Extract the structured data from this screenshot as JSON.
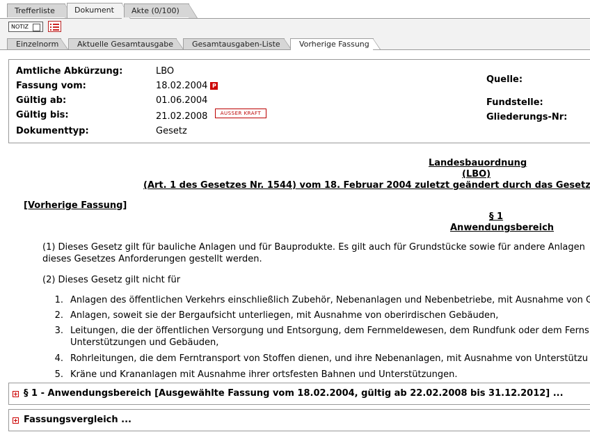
{
  "top_tabs": [
    {
      "label": "Trefferliste"
    },
    {
      "label": "Dokument"
    },
    {
      "label": "Akte (0/100)"
    }
  ],
  "toolbar": {
    "notiz_label": "NOTIZ"
  },
  "sub_tabs": [
    {
      "label": "Einzelnorm"
    },
    {
      "label": "Aktuelle Gesamtausgabe"
    },
    {
      "label": "Gesamtausgaben-Liste"
    },
    {
      "label": "Vorherige Fassung"
    }
  ],
  "meta": {
    "abk_label": "Amtliche Abkürzung:",
    "abk_value": "LBO",
    "fassung_label": "Fassung vom:",
    "fassung_value": "18.02.2004",
    "pdf_icon_text": "P",
    "gueltig_ab_label": "Gültig ab:",
    "gueltig_ab_value": "01.06.2004",
    "gueltig_bis_label": "Gültig bis:",
    "gueltig_bis_value": "21.02.2008",
    "ausser_kraft": "AUSSER KRAFT",
    "doctype_label": "Dokumenttyp:",
    "doctype_value": "Gesetz",
    "quelle_label": "Quelle:",
    "fundstelle_label": "Fundstelle:",
    "gliederung_label": "Gliederungs-Nr:"
  },
  "doc": {
    "title1": "Landesbauordnung",
    "title2": "(LBO)",
    "title3": "(Art. 1 des Gesetzes Nr. 1544) vom 18. Februar 2004 zuletzt geändert durch das Gesetz",
    "prev_link": "[Vorherige Fassung]",
    "para_sign": "§ 1",
    "para_title": "Anwendungsbereich",
    "p1_line1": "(1) Dieses Gesetz gilt für bauliche Anlagen und für Bauprodukte. Es gilt auch für Grundstücke sowie für andere Anlagen",
    "p1_line2": "dieses Gesetzes Anforderungen gestellt werden.",
    "p2": "(2) Dieses Gesetz gilt nicht für",
    "items": [
      {
        "num": "1.",
        "line1": "Anlagen des öffentlichen Verkehrs einschließlich Zubehör, Nebenanlagen und Nebenbetriebe, mit Ausnahme von G",
        "line2": ""
      },
      {
        "num": "2.",
        "line1": "Anlagen, soweit sie der Bergaufsicht unterliegen, mit Ausnahme von oberirdischen Gebäuden,",
        "line2": ""
      },
      {
        "num": "3.",
        "line1": "Leitungen, die der öffentlichen Versorgung und Entsorgung, dem Fernmeldewesen, dem Rundfunk oder dem Ferns",
        "line2": "Unterstützungen und Gebäuden,"
      },
      {
        "num": "4.",
        "line1": "Rohrleitungen, die dem Ferntransport von Stoffen dienen, und ihre Nebenanlagen, mit Ausnahme von Unterstützu",
        "line2": ""
      },
      {
        "num": "5.",
        "line1": "Kräne und Krananlagen mit Ausnahme ihrer ortsfesten Bahnen und Unterstützungen.",
        "line2": ""
      }
    ]
  },
  "sections": [
    {
      "label": "§ 1 - Anwendungsbereich [Ausgewählte Fassung vom 18.02.2004, gültig ab 22.02.2008 bis 31.12.2012] ..."
    },
    {
      "label": "Fassungsvergleich ..."
    }
  ]
}
